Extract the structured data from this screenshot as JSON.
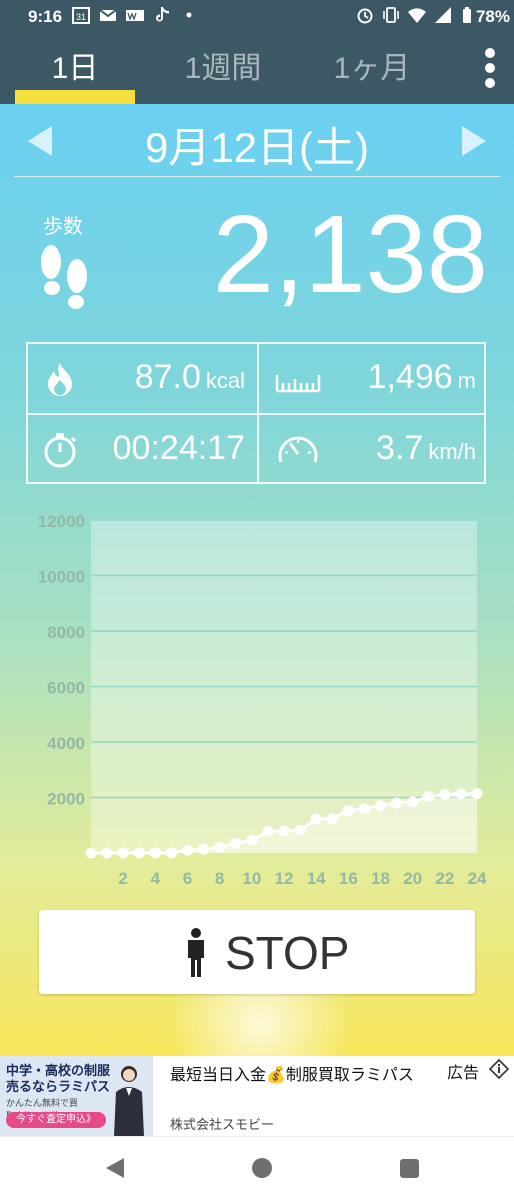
{
  "status_bar": {
    "time": "9:16",
    "notification_icons": [
      "calendar-31-icon",
      "gmail-icon",
      "wwm-icon",
      "tiktok-icon",
      "dot-icon"
    ],
    "calendar_day": "31",
    "system_icons": [
      "alarm-icon",
      "vibrate-icon",
      "wifi-icon",
      "signal-icon",
      "battery-icon"
    ],
    "battery": "78%"
  },
  "tabs": [
    {
      "label": "1日",
      "selected": true
    },
    {
      "label": "1週間",
      "selected": false
    },
    {
      "label": "1ヶ月",
      "selected": false
    }
  ],
  "date": {
    "label": "9月12日(土)"
  },
  "steps": {
    "label": "歩数",
    "value": "2,138"
  },
  "stats": {
    "kcal": {
      "value": "87.0",
      "unit": "kcal"
    },
    "distance": {
      "value": "1,496",
      "unit": "m"
    },
    "time": {
      "value": "00:24:17"
    },
    "speed": {
      "value": "3.7",
      "unit": "km/h"
    }
  },
  "chart_data": {
    "type": "area",
    "x": [
      0,
      1,
      2,
      3,
      4,
      5,
      6,
      7,
      8,
      9,
      10,
      11,
      12,
      13,
      14,
      15,
      16,
      17,
      18,
      19,
      20,
      21,
      22,
      23,
      24
    ],
    "values": [
      0,
      0,
      0,
      0,
      0,
      0,
      100,
      130,
      200,
      350,
      460,
      780,
      790,
      820,
      1220,
      1240,
      1530,
      1600,
      1710,
      1800,
      1840,
      2030,
      2110,
      2130,
      2138
    ],
    "x_tick_labels": [
      "2",
      "4",
      "6",
      "8",
      "10",
      "12",
      "14",
      "16",
      "18",
      "20",
      "22",
      "24"
    ],
    "y_tick_labels": [
      "2000",
      "4000",
      "6000",
      "8000",
      "10000",
      "12000"
    ],
    "xlim": [
      0,
      24
    ],
    "ylim": [
      0,
      12000
    ],
    "grid": true,
    "colors": {
      "line": "#ffffff",
      "fill": "rgba(255,255,255,0.35)",
      "grid": "#8fd8c8",
      "label": "#94b8a6"
    }
  },
  "stop_button": {
    "label": "STOP"
  },
  "ad": {
    "image_line1": "中学・高校の制服",
    "image_line2": "売るならラミパス",
    "image_line3": "かんたん無料で買取申込み可能!",
    "image_cta": "今すぐ査定申込》",
    "headline": "最短当日入金💰制服買取ラミパス",
    "label": "広告",
    "advertiser": "株式会社スモビー"
  },
  "colors": {
    "header": "#3c5864",
    "tab_indicator": "#f4df3c",
    "inactive_tab": "#a8b7bd"
  }
}
